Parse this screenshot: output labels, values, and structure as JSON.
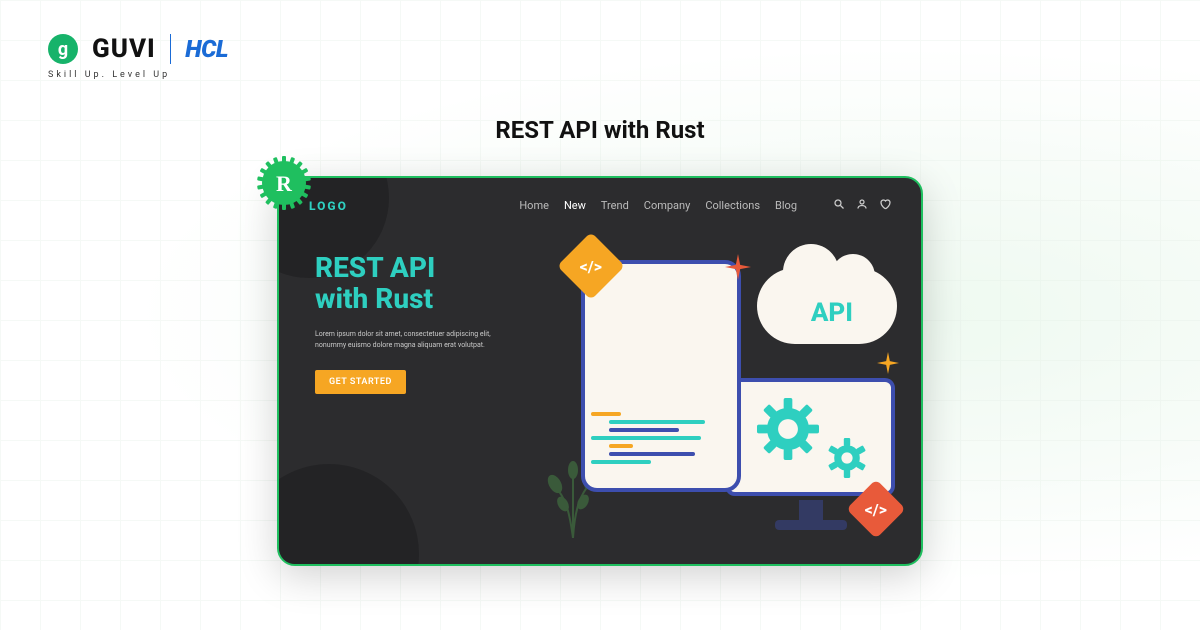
{
  "brand": {
    "guvi": "GUVI",
    "guvi_badge_letter": "g",
    "hcl": "HCL",
    "tagline": "Skill Up. Level Up"
  },
  "page_title": "REST API with Rust",
  "card": {
    "logo_label": "LOGO",
    "nav_items": [
      {
        "label": "Home",
        "active": false
      },
      {
        "label": "New",
        "active": true
      },
      {
        "label": "Trend",
        "active": false
      },
      {
        "label": "Company",
        "active": false
      },
      {
        "label": "Collections",
        "active": false
      },
      {
        "label": "Blog",
        "active": false
      }
    ],
    "hero": {
      "title_line1": "REST API",
      "title_line2": "with Rust",
      "description": "Lorem ipsum dolor sit amet, consectetuer adipiscing elit, nonummy euismo dolore magna aliquam erat volutpat.",
      "cta_label": "GET STARTED"
    },
    "cloud_label": "API",
    "code_symbol": "</>"
  },
  "colors": {
    "accent_green": "#1fbf5f",
    "teal": "#2ecfc0",
    "orange": "#f6a623",
    "red_orange": "#e85a3a",
    "indigo": "#3d4eae"
  },
  "code_lines": [
    {
      "w": 30,
      "c": "#f6a623"
    },
    {
      "w": 96,
      "c": "#2ecfc0"
    },
    {
      "w": 70,
      "c": "#3d4eae"
    },
    {
      "w": 110,
      "c": "#2ecfc0"
    },
    {
      "w": 24,
      "c": "#f6a623"
    },
    {
      "w": 86,
      "c": "#3d4eae"
    },
    {
      "w": 60,
      "c": "#2ecfc0"
    }
  ]
}
